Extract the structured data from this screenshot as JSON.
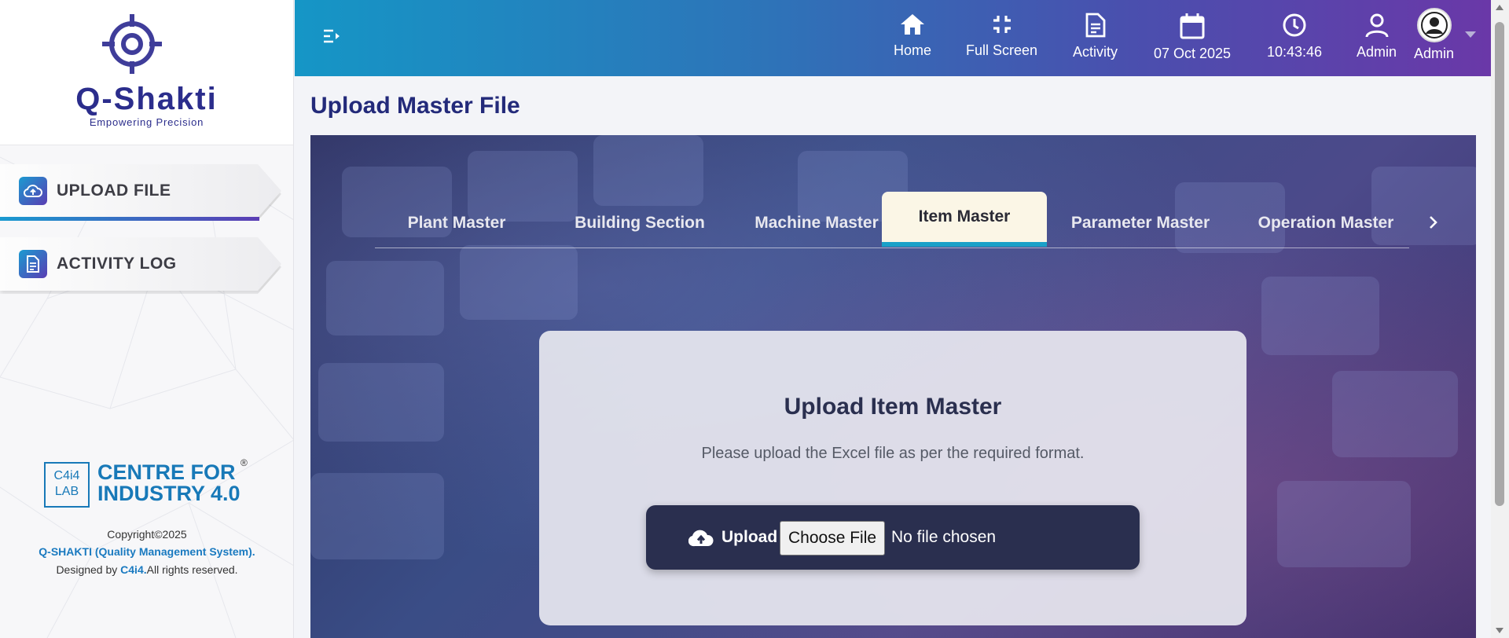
{
  "brand": {
    "name": "Q-Shakti",
    "tagline": "Empowering Precision"
  },
  "sidebar": {
    "items": [
      {
        "label": "UPLOAD FILE",
        "icon": "cloud-upload-icon",
        "active": true
      },
      {
        "label": "ACTIVITY LOG",
        "icon": "document-icon",
        "active": false
      }
    ]
  },
  "footer": {
    "logo_box_line1": "C4i4",
    "logo_box_line2": "LAB",
    "logo_name_line1": "CENTRE FOR",
    "logo_name_line2": "INDUSTRY 4.0",
    "registered": "®",
    "copyright": "Copyright©2025",
    "product": "Q-SHAKTI (Quality Management System).",
    "designed_prefix": "Designed by ",
    "designed_company": "C4i4.",
    "designed_suffix": "All rights reserved."
  },
  "header": {
    "home": "Home",
    "fullscreen": "Full Screen",
    "activity": "Activity",
    "date": "07 Oct 2025",
    "time": "10:43:46",
    "user": "Admin",
    "profile": "Admin"
  },
  "main": {
    "title": "Upload Master File",
    "tabs": [
      {
        "label": "Plant Master",
        "active": false
      },
      {
        "label": "Building Section",
        "active": false
      },
      {
        "label": "Machine Master",
        "active": false
      },
      {
        "label": "Item Master",
        "active": true
      },
      {
        "label": "Parameter Master",
        "active": false
      },
      {
        "label": "Operation Master",
        "active": false
      }
    ],
    "card": {
      "title": "Upload Item Master",
      "description": "Please upload the Excel file as per the required format.",
      "upload_label": "Upload",
      "choose_button": "Choose File",
      "file_status": "No file chosen"
    }
  },
  "colors": {
    "accent": "#1aa0c8",
    "brand_navy": "#232a7a",
    "header_start": "#1596c6",
    "header_end": "#6a38a8"
  }
}
